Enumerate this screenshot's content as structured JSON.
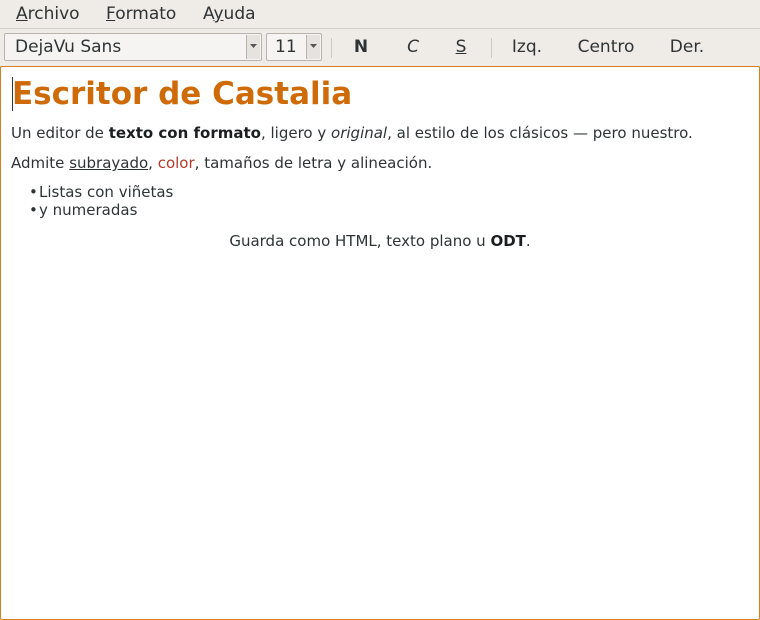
{
  "menu": {
    "items": [
      {
        "accel": "A",
        "rest": "rchivo"
      },
      {
        "accel": "F",
        "rest": "ormato"
      },
      {
        "pre": "A",
        "accel": "y",
        "rest": "uda"
      }
    ]
  },
  "toolbar": {
    "font_value": "DejaVu Sans",
    "size_value": "11",
    "bold_label": "N",
    "italic_label": "C",
    "underline_label": "S",
    "align_left_label": "Izq.",
    "align_center_label": "Centro",
    "align_right_label": "Der."
  },
  "document": {
    "title": "Escritor de Castalia",
    "p1": {
      "a": "Un editor de ",
      "bold": "texto con formato",
      "b": ", ligero y ",
      "italic": "original",
      "c": ", al estilo de los clásicos — pero nuestro."
    },
    "p2": {
      "a": "Admite ",
      "underlined": "subrayado",
      "b": ", ",
      "colored": "color",
      "c": ", tamaños de letra y alineación."
    },
    "bullets": [
      "Listas con viñetas",
      "y numeradas"
    ],
    "p3": {
      "a": "Guarda como HTML, texto plano u ",
      "bold": "ODT",
      "b": "."
    }
  },
  "colors": {
    "accent": "#ce6b08",
    "focus_border": "#d97f1e",
    "red_text": "#b33a2a",
    "chrome_bg": "#efebe7"
  }
}
